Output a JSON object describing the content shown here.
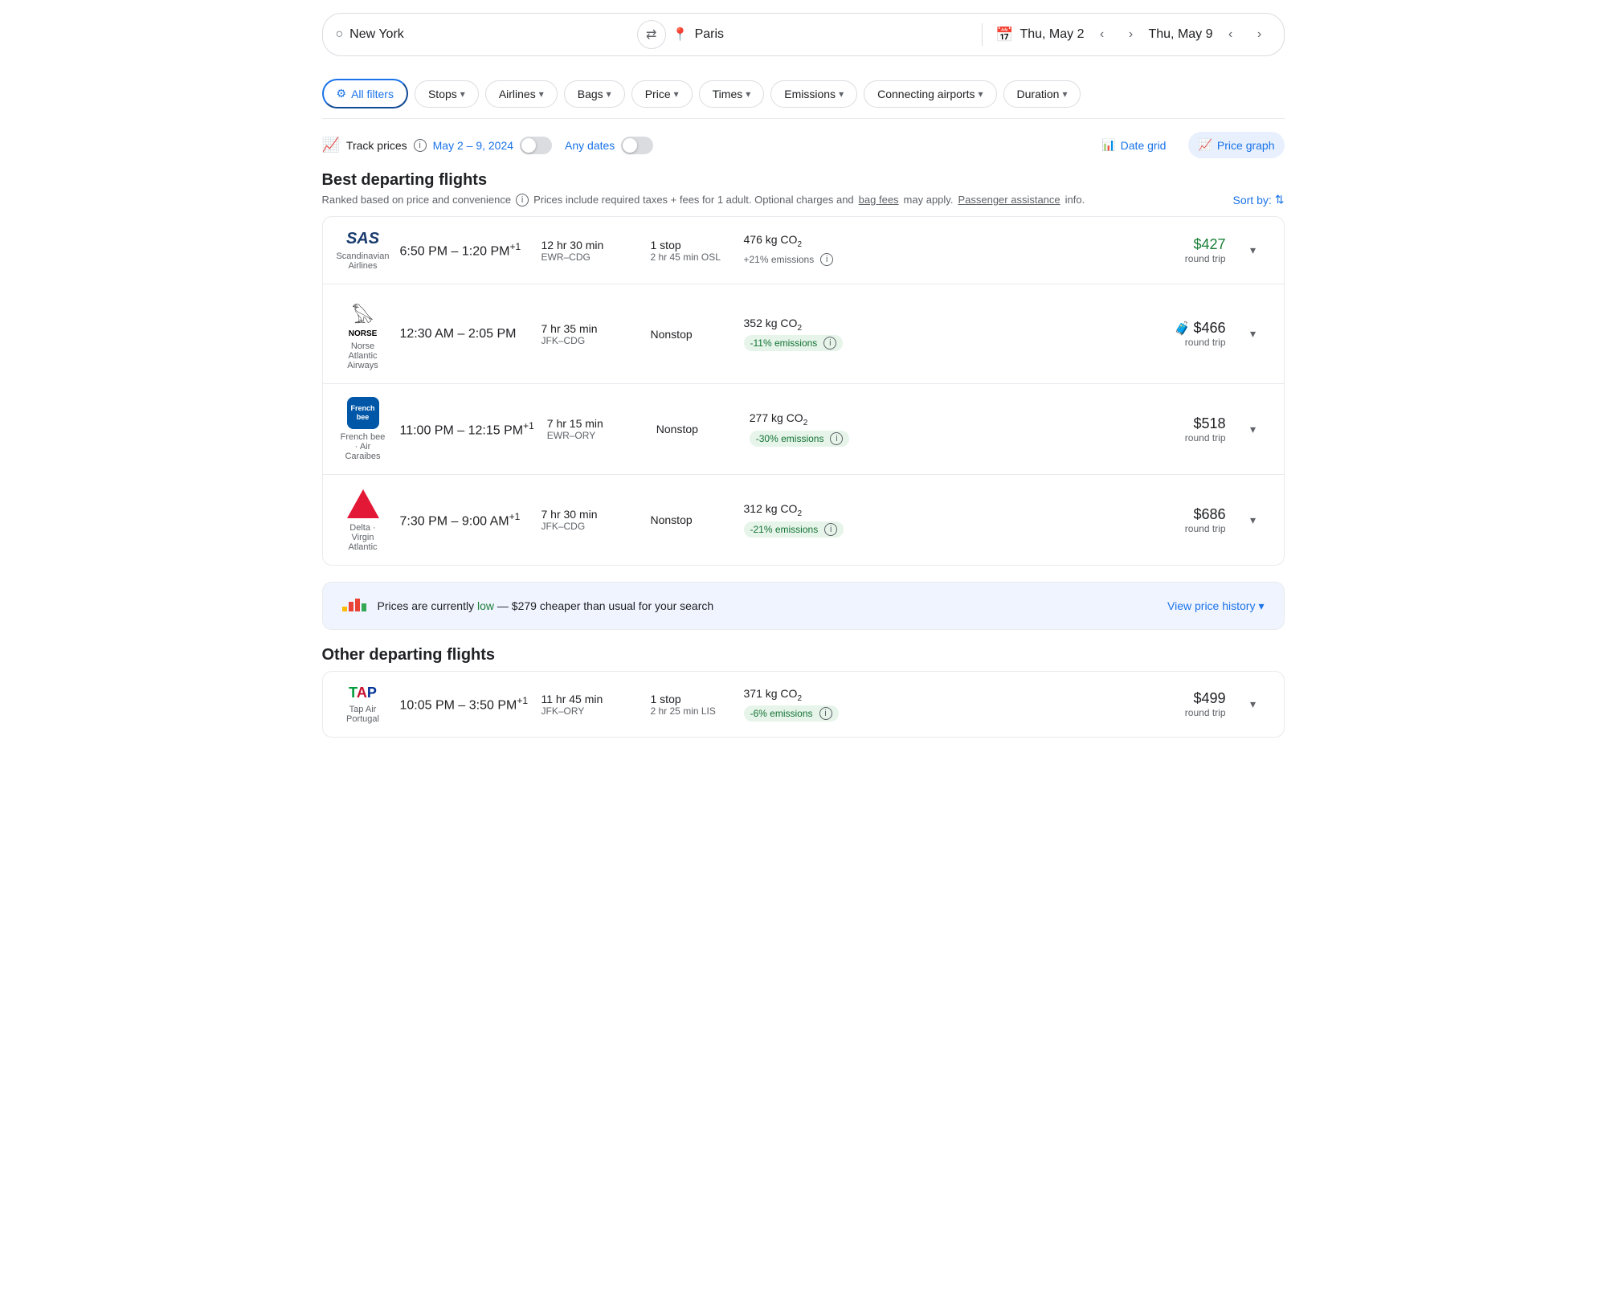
{
  "search": {
    "origin": "New York",
    "destination": "Paris",
    "date_from": "Thu, May 2",
    "date_to": "Thu, May 9",
    "swap_label": "⇄"
  },
  "filters": {
    "all_filters": "All filters",
    "stops": "Stops",
    "airlines": "Airlines",
    "bags": "Bags",
    "price": "Price",
    "times": "Times",
    "emissions": "Emissions",
    "connecting_airports": "Connecting airports",
    "duration": "Duration"
  },
  "track": {
    "label": "Track prices",
    "dates": "May 2 – 9, 2024",
    "any_dates": "Any dates"
  },
  "views": {
    "date_grid": "Date grid",
    "price_graph": "Price graph"
  },
  "best_flights": {
    "title": "Best departing flights",
    "subtitle": "Ranked based on price and convenience",
    "price_info": "Prices include required taxes + fees for 1 adult. Optional charges and",
    "bag_fees": "bag fees",
    "may_apply": "may apply.",
    "passenger": "Passenger assistance",
    "info_suffix": "info.",
    "sort_by": "Sort by:"
  },
  "flights": [
    {
      "airline": "SAS",
      "airline_full": "Scandinavian Airlines",
      "depart": "6:50 PM",
      "arrive": "1:20 PM",
      "arrive_offset": "+1",
      "duration": "12 hr 30 min",
      "route": "EWR–CDG",
      "stops": "1 stop",
      "stop_detail": "2 hr 45 min OSL",
      "co2": "476 kg CO₂",
      "emissions_pct": "+21% emissions",
      "emissions_type": "positive",
      "price": "$427",
      "price_class": "cheap",
      "trip_type": "round trip"
    },
    {
      "airline": "NORSE",
      "airline_full": "Norse Atlantic Airways",
      "depart": "12:30 AM",
      "arrive": "2:05 PM",
      "arrive_offset": "",
      "duration": "7 hr 35 min",
      "route": "JFK–CDG",
      "stops": "Nonstop",
      "stop_detail": "",
      "co2": "352 kg CO₂",
      "emissions_pct": "-11% emissions",
      "emissions_type": "negative",
      "price": "$466",
      "price_class": "",
      "trip_type": "round trip",
      "has_baggage_icon": true
    },
    {
      "airline": "FRENCHBEE",
      "airline_full": "French bee · Air Caraibes",
      "depart": "11:00 PM",
      "arrive": "12:15 PM",
      "arrive_offset": "+1",
      "duration": "7 hr 15 min",
      "route": "EWR–ORY",
      "stops": "Nonstop",
      "stop_detail": "",
      "co2": "277 kg CO₂",
      "emissions_pct": "-30% emissions",
      "emissions_type": "negative",
      "price": "$518",
      "price_class": "",
      "trip_type": "round trip"
    },
    {
      "airline": "DELTA",
      "airline_full": "Delta · Virgin Atlantic",
      "depart": "7:30 PM",
      "arrive": "9:00 AM",
      "arrive_offset": "+1",
      "duration": "7 hr 30 min",
      "route": "JFK–CDG",
      "stops": "Nonstop",
      "stop_detail": "",
      "co2": "312 kg CO₂",
      "emissions_pct": "-21% emissions",
      "emissions_type": "negative",
      "price": "$686",
      "price_class": "",
      "trip_type": "round trip"
    }
  ],
  "price_banner": {
    "text_prefix": "Prices are currently",
    "status": "low",
    "text_suffix": "— $279 cheaper than usual for your search",
    "view_history": "View price history"
  },
  "other_flights": {
    "title": "Other departing flights",
    "flights": [
      {
        "airline": "TAP",
        "airline_full": "Tap Air Portugal",
        "depart": "10:05 PM",
        "arrive": "3:50 PM",
        "arrive_offset": "+1",
        "duration": "11 hr 45 min",
        "route": "JFK–ORY",
        "stops": "1 stop",
        "stop_detail": "2 hr 25 min LIS",
        "co2": "371 kg CO₂",
        "emissions_pct": "-6% emissions",
        "emissions_type": "negative",
        "price": "$499",
        "price_class": "",
        "trip_type": "round trip"
      }
    ]
  }
}
